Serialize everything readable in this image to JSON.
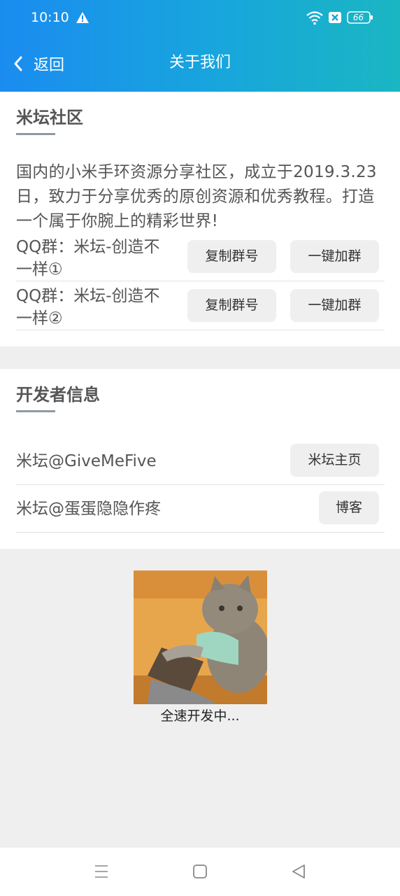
{
  "status_bar": {
    "time": "10:10",
    "battery": "66"
  },
  "header": {
    "back_label": "返回",
    "title": "关于我们"
  },
  "community": {
    "title": "米坛社区",
    "intro": "国内的小米手环资源分享社区，成立于2019.3.23日，致力于分享优秀的原创资源和优秀教程。打造一个属于你腕上的精彩世界!",
    "groups": [
      {
        "line1": "QQ群：米坛-创造不",
        "line2": "一样①",
        "copy_label": "复制群号",
        "join_label": "一键加群"
      },
      {
        "line1": "QQ群：米坛-创造不",
        "line2": "一样②",
        "copy_label": "复制群号",
        "join_label": "一键加群"
      }
    ]
  },
  "developers": {
    "title": "开发者信息",
    "items": [
      {
        "name": "米坛@GiveMeFive",
        "button": "米坛主页"
      },
      {
        "name": "米坛@蛋蛋隐隐作疼",
        "button": "博客"
      }
    ]
  },
  "footer": {
    "caption": "全速开发中..."
  },
  "colors": {
    "header_start": "#1a8cf0",
    "header_end": "#1ab6c2",
    "button_bg": "#efefef",
    "page_bg": "#efefef"
  },
  "icons": [
    "warning-icon",
    "wifi-icon",
    "sim-icon",
    "battery-icon",
    "back-icon",
    "menu-icon",
    "home-icon",
    "back-triangle-icon"
  ]
}
